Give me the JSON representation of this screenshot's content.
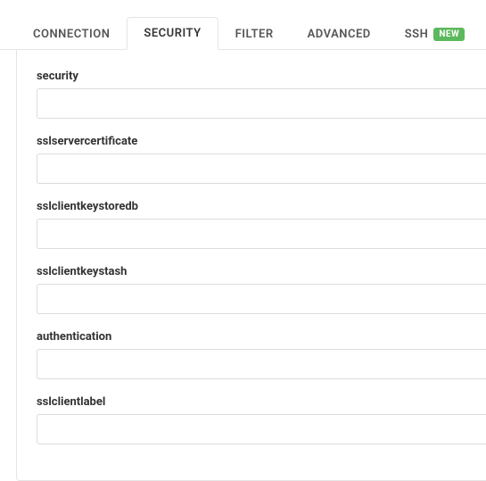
{
  "tabs": [
    {
      "label": "CONNECTION",
      "active": false
    },
    {
      "label": "SECURITY",
      "active": true
    },
    {
      "label": "FILTER",
      "active": false
    },
    {
      "label": "ADVANCED",
      "active": false
    },
    {
      "label": "SSH",
      "active": false,
      "badge": "NEW"
    }
  ],
  "form": {
    "fields": [
      {
        "label": "security",
        "value": ""
      },
      {
        "label": "sslservercertificate",
        "value": ""
      },
      {
        "label": "sslclientkeystoredb",
        "value": ""
      },
      {
        "label": "sslclientkeystash",
        "value": ""
      },
      {
        "label": "authentication",
        "value": ""
      },
      {
        "label": "sslclientlabel",
        "value": ""
      }
    ]
  }
}
